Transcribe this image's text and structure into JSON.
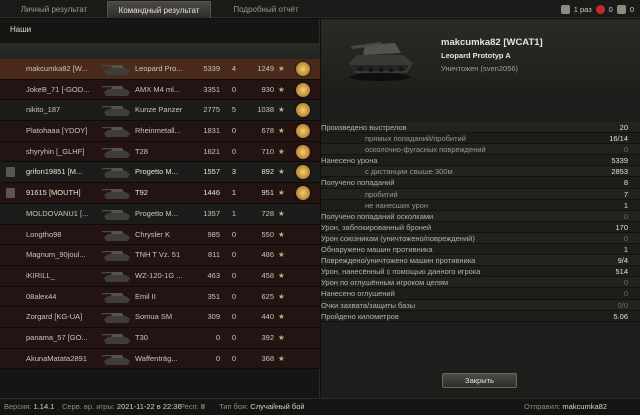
{
  "tabs": [
    {
      "label": "Личный результат",
      "active": false
    },
    {
      "label": "Командный результат",
      "active": true
    },
    {
      "label": "Подробный отчёт",
      "active": false
    }
  ],
  "top_right": {
    "count1": "1 раз",
    "count2": "0",
    "count3": "0"
  },
  "team": {
    "title": "Наши",
    "rows": [
      {
        "name": "makcumka82 [W...",
        "vehicle": "Leopard Pro...",
        "damage": "5339",
        "frags": "4",
        "xp": "1249",
        "status": "me",
        "squad": false,
        "medal": true
      },
      {
        "name": "JokeB_71 [-GOD...",
        "vehicle": "AMX M4 ml...",
        "damage": "3351",
        "frags": "0",
        "xp": "930",
        "status": "dead",
        "squad": false,
        "medal": true
      },
      {
        "name": "nikito_187",
        "vehicle": "Kunze Panzer",
        "damage": "2775",
        "frags": "5",
        "xp": "1038",
        "status": "alive",
        "squad": false,
        "medal": true
      },
      {
        "name": "Platohaaa [YDOY]",
        "vehicle": "Rheinmetall...",
        "damage": "1831",
        "frags": "0",
        "xp": "678",
        "status": "dead",
        "squad": false,
        "medal": true
      },
      {
        "name": "shyryhin [_GLHF]",
        "vehicle": "T28",
        "damage": "1621",
        "frags": "0",
        "xp": "710",
        "status": "dead",
        "squad": false,
        "medal": true
      },
      {
        "name": "grifon19851 [M...",
        "vehicle": "Progetto M...",
        "damage": "1557",
        "frags": "3",
        "xp": "892",
        "status": "alive",
        "squad": true,
        "medal": true
      },
      {
        "name": "91615 [MOUTH]",
        "vehicle": "T92",
        "damage": "1446",
        "frags": "1",
        "xp": "951",
        "status": "dead",
        "squad": true,
        "medal": true
      },
      {
        "name": "MOLDOVANU1 [...",
        "vehicle": "Progetto M...",
        "damage": "1357",
        "frags": "1",
        "xp": "728",
        "status": "alive",
        "squad": false,
        "medal": false
      },
      {
        "name": "Longtho98",
        "vehicle": "Chrysler K",
        "damage": "985",
        "frags": "0",
        "xp": "550",
        "status": "dead",
        "squad": false,
        "medal": false
      },
      {
        "name": "Magnum_90joul...",
        "vehicle": "TNH T Vz. 51",
        "damage": "811",
        "frags": "0",
        "xp": "486",
        "status": "dead",
        "squad": false,
        "medal": false
      },
      {
        "name": "iKIRILL_",
        "vehicle": "WZ-120-1G ...",
        "damage": "463",
        "frags": "0",
        "xp": "458",
        "status": "dead",
        "squad": false,
        "medal": false
      },
      {
        "name": "08alex44",
        "vehicle": "Emil II",
        "damage": "351",
        "frags": "0",
        "xp": "625",
        "status": "dead",
        "squad": false,
        "medal": false
      },
      {
        "name": "Zorgard [KG-UA]",
        "vehicle": "Somua SM",
        "damage": "309",
        "frags": "0",
        "xp": "440",
        "status": "dead",
        "squad": false,
        "medal": false
      },
      {
        "name": "panama_57 [GO...",
        "vehicle": "T30",
        "damage": "0",
        "frags": "0",
        "xp": "392",
        "status": "dead",
        "squad": false,
        "medal": false
      },
      {
        "name": "AkunaMatata2891",
        "vehicle": "Waffenträg...",
        "damage": "0",
        "frags": "0",
        "xp": "368",
        "status": "dead",
        "squad": false,
        "medal": false
      }
    ]
  },
  "detail": {
    "player": "makcumka82 [WCAT1]",
    "tank": "Leopard Prototyp A",
    "status": "Уничтожен (sven2056)",
    "stats": [
      {
        "label": "Произведено выстрелов",
        "value": "20",
        "sub": false
      },
      {
        "label": "прямых попаданий/пробитий",
        "value": "16/14",
        "sub": true
      },
      {
        "label": "осколочно-фугасных повреждений",
        "value": "0",
        "sub": true
      },
      {
        "label": "Нанесено урона",
        "value": "5339",
        "sub": false
      },
      {
        "label": "с дистанции свыше 300м",
        "value": "2853",
        "sub": true
      },
      {
        "label": "Получено попаданий",
        "value": "8",
        "sub": false
      },
      {
        "label": "пробитий",
        "value": "7",
        "sub": true
      },
      {
        "label": "не нанесших урон",
        "value": "1",
        "sub": true
      },
      {
        "label": "Получено попаданий осколками",
        "value": "0",
        "sub": false
      },
      {
        "label": "Урон, заблокированный броней",
        "value": "170",
        "sub": false
      },
      {
        "label": "Урон союзникам (уничтожено/повреждений)",
        "value": "0",
        "sub": false
      },
      {
        "label": "Обнаружено машин противника",
        "value": "1",
        "sub": false
      },
      {
        "label": "Повреждено/уничтожено машин противника",
        "value": "9/4",
        "sub": false
      },
      {
        "label": "Урон, нанесённый с помощью данного игрока",
        "value": "514",
        "sub": false
      },
      {
        "label": "Урон по оглушённым игроком целям",
        "value": "0",
        "sub": false
      },
      {
        "label": "Нанесено оглушений",
        "value": "0",
        "sub": false
      },
      {
        "label": "Очки захвата/защиты базы",
        "value": "0/0",
        "sub": false
      },
      {
        "label": "Пройдено километров",
        "value": "5.06",
        "sub": false
      }
    ],
    "close_label": "Закрыть"
  },
  "footer": {
    "version_label": "Версия:",
    "version": "1.14.1",
    "server_label": "Серв. вр. игры:",
    "server_time": "2021-11-22 в 22:36",
    "respawn_label": "Респ:",
    "respawn": "II",
    "battle_type_label": "Тип боя:",
    "battle_type": "Случайный бой",
    "sender_label": "Отправил:",
    "sender": "makcumka82"
  }
}
